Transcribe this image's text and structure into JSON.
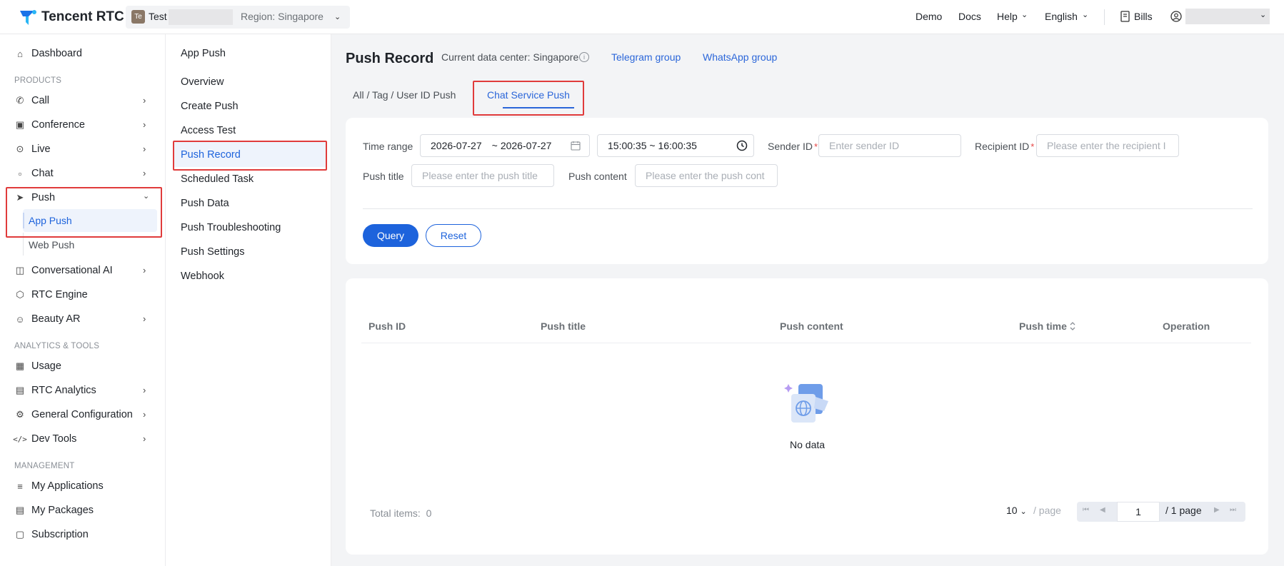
{
  "colors": {
    "accent": "#1d63dc",
    "link": "#2b66d9",
    "highlight_box": "#e03b3b",
    "required": "#e54545"
  },
  "topbar": {
    "brand": "Tencent RTC",
    "app_avatar": "Te",
    "app_name": "Test",
    "region": "Region: Singapore",
    "links": {
      "demo": "Demo",
      "docs": "Docs",
      "help": "Help",
      "language": "English",
      "bills": "Bills"
    }
  },
  "sidebar": {
    "dashboard": "Dashboard",
    "section_products": "PRODUCTS",
    "call": "Call",
    "conference": "Conference",
    "live": "Live",
    "chat": "Chat",
    "push": "Push",
    "app_push": "App Push",
    "web_push": "Web Push",
    "conversational_ai": "Conversational AI",
    "rtc_engine": "RTC Engine",
    "beauty_ar": "Beauty AR",
    "section_analytics": "ANALYTICS & TOOLS",
    "usage": "Usage",
    "rtc_analytics": "RTC Analytics",
    "general_configuration": "General Configuration",
    "dev_tools": "Dev Tools",
    "section_management": "MANAGEMENT",
    "my_applications": "My Applications",
    "my_packages": "My Packages",
    "subscription": "Subscription"
  },
  "subnav": {
    "title": "App Push",
    "items": [
      "Overview",
      "Create Push",
      "Access Test",
      "Push Record",
      "Scheduled Task",
      "Push Data",
      "Push Troubleshooting",
      "Push Settings",
      "Webhook"
    ],
    "active": "Push Record"
  },
  "main": {
    "title": "Push Record",
    "data_center": "Current data center: Singapore",
    "telegram": "Telegram group",
    "whatsapp": "WhatsApp group",
    "tabs": [
      "All / Tag / User ID Push",
      "Chat Service Push"
    ],
    "active_tab": "Chat Service Push"
  },
  "filters": {
    "time_range_label": "Time range",
    "date_start": "2026-07-27",
    "date_sep": "~",
    "date_end": "2026-07-27",
    "time_value": "15:00:35 ~ 16:00:35",
    "sender_label": "Sender ID",
    "sender_placeholder": "Enter sender ID",
    "recipient_label": "Recipient ID",
    "recipient_placeholder": "Please enter the recipient I",
    "push_title_label": "Push title",
    "push_title_placeholder": "Please enter the push title",
    "push_content_label": "Push content",
    "push_content_placeholder": "Please enter the push cont",
    "query": "Query",
    "reset": "Reset"
  },
  "table": {
    "columns": [
      "Push ID",
      "Push title",
      "Push content",
      "Push time",
      "Operation"
    ],
    "rows": [],
    "empty_text": "No data",
    "total_label": "Total items:",
    "total_value": "0",
    "page_size": "10",
    "page_size_suffix": "/ page",
    "current_page": "1",
    "page_total": "/ 1 page"
  }
}
